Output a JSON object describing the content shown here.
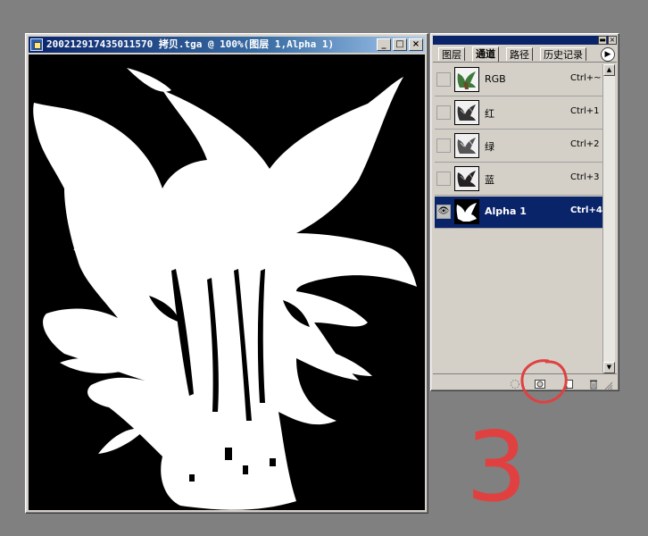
{
  "document_window": {
    "title": "200212917435011570 拷贝.tga @ 100%(图层 1,Alpha 1)",
    "minimize_glyph": "_",
    "maximize_glyph": "□",
    "close_glyph": "×"
  },
  "channels_panel": {
    "close_glyph": "×",
    "minimize_glyph": "▬",
    "menu_glyph": "▶",
    "tabs": [
      {
        "label": "图层",
        "active": false
      },
      {
        "label": "通道",
        "active": true
      },
      {
        "label": "路径",
        "active": false
      },
      {
        "label": "历史记录",
        "active": false
      }
    ],
    "channels": [
      {
        "name": "RGB",
        "shortcut": "Ctrl+~",
        "visible": false,
        "selected": false
      },
      {
        "name": "红",
        "shortcut": "Ctrl+1",
        "visible": false,
        "selected": false
      },
      {
        "name": "绿",
        "shortcut": "Ctrl+2",
        "visible": false,
        "selected": false
      },
      {
        "name": "蓝",
        "shortcut": "Ctrl+3",
        "visible": false,
        "selected": false
      },
      {
        "name": "Alpha 1",
        "shortcut": "Ctrl+4",
        "visible": true,
        "selected": true
      }
    ],
    "eye_glyph": "👁",
    "footer_icons": [
      "load-selection-icon",
      "save-selection-icon",
      "new-channel-icon",
      "trash-icon"
    ]
  },
  "annotation": {
    "step_number": "3",
    "color": "#e04040"
  }
}
